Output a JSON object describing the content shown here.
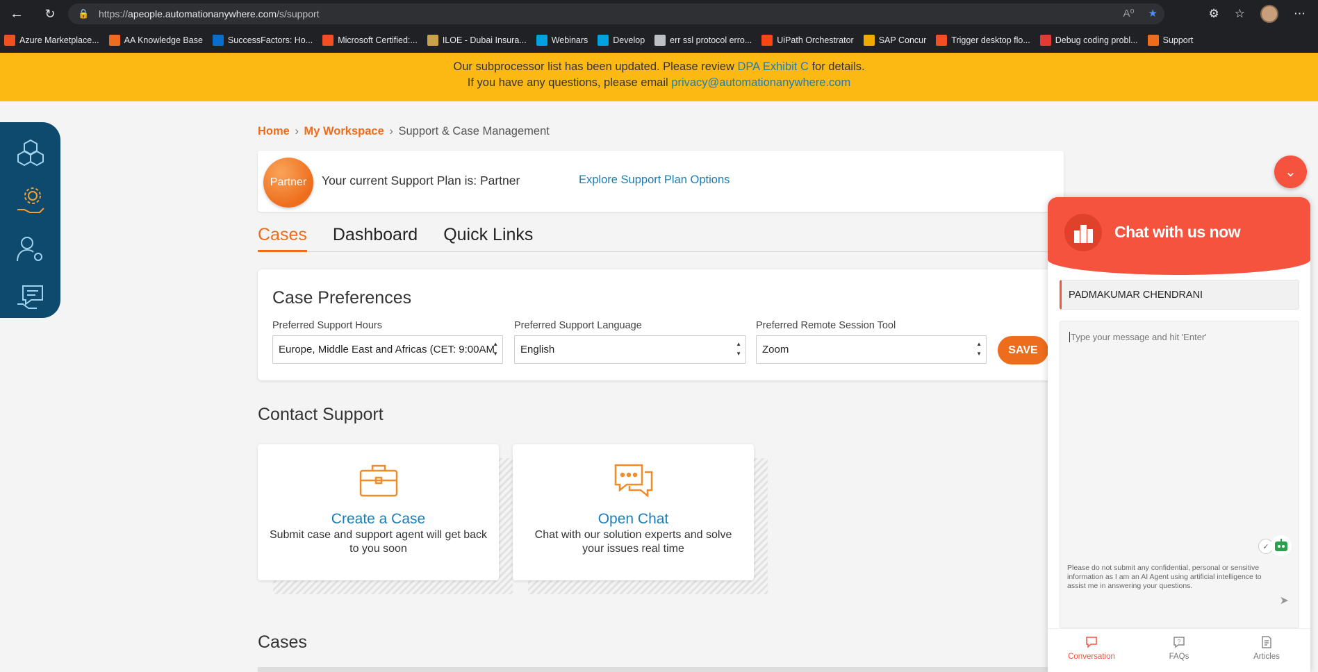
{
  "browser": {
    "url_prefix": "https://",
    "url_host": "apeople.automationanywhere.com",
    "url_path": "/s/support",
    "bookmarks": [
      {
        "label": "Azure Marketplace...",
        "icon": "microsoft-icon",
        "color": "#f25022"
      },
      {
        "label": "AA Knowledge Base",
        "icon": "aa-logo-icon",
        "color": "#ee6d1c"
      },
      {
        "label": "SuccessFactors: Ho...",
        "icon": "heart-icon",
        "color": "#0a6ed1"
      },
      {
        "label": "Microsoft Certified:...",
        "icon": "microsoft-icon",
        "color": "#f25022"
      },
      {
        "label": "ILOE - Dubai Insura...",
        "icon": "bird-icon",
        "color": "#c9a14a"
      },
      {
        "label": "Webinars",
        "icon": "salesforce-cloud-icon",
        "color": "#00a1e0"
      },
      {
        "label": "Develop",
        "icon": "salesforce-cloud-icon",
        "color": "#00a1e0"
      },
      {
        "label": "err ssl protocol erro...",
        "icon": "globe-icon",
        "color": "#bdc1c6"
      },
      {
        "label": "UiPath Orchestrator",
        "icon": "uipath-icon",
        "color": "#fa4616"
      },
      {
        "label": "SAP Concur",
        "icon": "concur-icon",
        "color": "#f0ab00"
      },
      {
        "label": "Trigger desktop flo...",
        "icon": "microsoft-icon",
        "color": "#f25022"
      },
      {
        "label": "Debug coding probl...",
        "icon": "c-icon",
        "color": "#e53935"
      },
      {
        "label": "Support",
        "icon": "aa-logo-icon",
        "color": "#ee6d1c"
      }
    ]
  },
  "banner": {
    "line1_pre": "Our subprocessor list has been updated. Please review ",
    "line1_link": "DPA Exhibit C",
    "line1_post": " for details.",
    "line2_pre": "If you have any questions, please email ",
    "line2_link": "privacy@automationanywhere.com"
  },
  "breadcrumb": {
    "home": "Home",
    "workspace": "My Workspace",
    "current": "Support & Case Management",
    "separator": "›"
  },
  "plan": {
    "badge": "Partner",
    "text": "Your current Support Plan is: Partner",
    "explore": "Explore Support Plan Options"
  },
  "tabs": [
    "Cases",
    "Dashboard",
    "Quick Links"
  ],
  "prefs": {
    "title": "Case Preferences",
    "hours_label": "Preferred Support Hours",
    "hours_value": "Europe, Middle East and Africas (CET: 9:00AM",
    "language_label": "Preferred Support Language",
    "language_value": "English",
    "tool_label": "Preferred Remote Session Tool",
    "tool_value": "Zoom",
    "save": "SAVE"
  },
  "contact": {
    "title": "Contact Support",
    "create_title": "Create a Case",
    "create_desc": "Submit case and support agent will get back to you soon",
    "chat_title": "Open Chat",
    "chat_desc": "Chat with our solution experts and solve your issues real time"
  },
  "cases_title": "Cases",
  "chat": {
    "title": "Chat with us now",
    "name": "PADMAKUMAR CHENDRANI",
    "placeholder": "Type your message and hit 'Enter'",
    "disclaimer": "Please do not submit any confidential, personal or sensitive information as I am an AI Agent using artificial intelligence to assist me in answering your questions.",
    "tabs": [
      "Conversation",
      "FAQs",
      "Articles"
    ]
  },
  "colors": {
    "accent": "#ee6d1c",
    "link": "#1a7db8",
    "banner": "#fdb913",
    "chat_header": "#f5533d",
    "dock": "#0e4a6e"
  }
}
